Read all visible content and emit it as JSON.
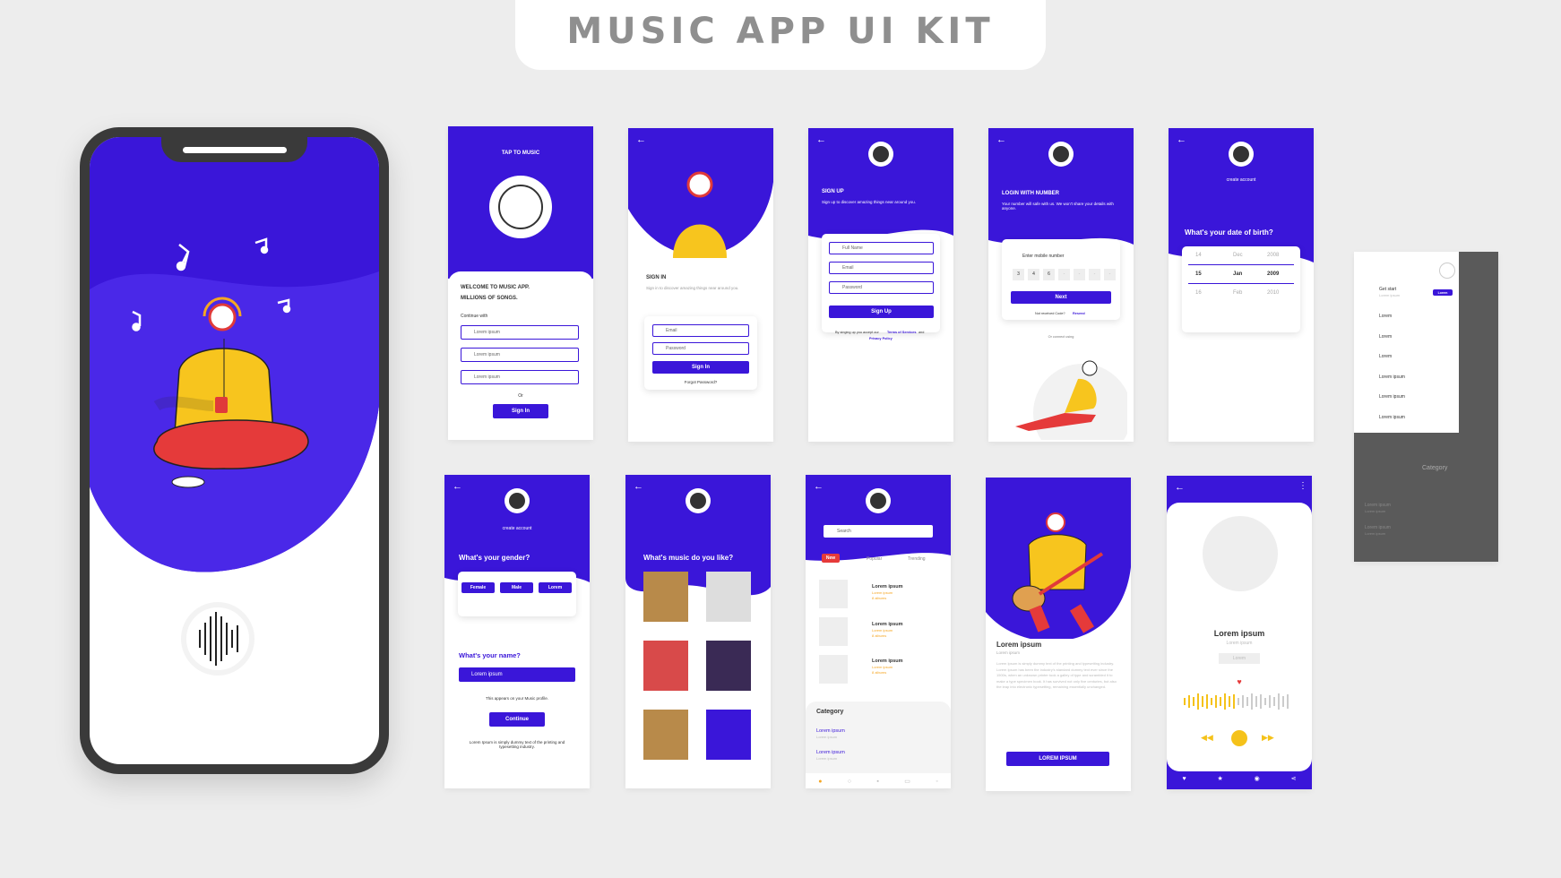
{
  "header": {
    "title": "MUSIC APP UI KIT"
  },
  "colors": {
    "primary": "#3a16d9",
    "accent": "#f5c21a",
    "red": "#e63a3a",
    "bg": "#ededed"
  },
  "tap_screen": {
    "title": "TAP TO MUSIC",
    "welcome": "WELCOME TO MUSIC APP.",
    "millions": "MILLIONS OF SONGS.",
    "continue_with": "Continue with",
    "options": [
      "Lorem ipsum",
      "Lorem ipsum",
      "Lorem ipsum"
    ],
    "or": "Or",
    "signin": "Sign In"
  },
  "signin_screen": {
    "title": "SIGN IN",
    "subtitle": "Sign in to discover amazing things near around you.",
    "email": "Email",
    "password": "Password",
    "button": "Sign In",
    "forgot": "Forgot Password?"
  },
  "signup_screen": {
    "title": "SIGN UP",
    "subtitle": "Sign up to discover amazing things near around you.",
    "fullname": "Full Name",
    "email": "Email",
    "password": "Password",
    "button": "Sign Up",
    "terms_pre": "By singing up you accept our",
    "terms": "Terms of Services",
    "and": "and",
    "privacy": "Privacy Policy"
  },
  "number_screen": {
    "title": "LOGIN WITH NUMBER",
    "subtitle": "Your number will safe with us. We won't share your details with anyone.",
    "placeholder": "Enter mobile number",
    "digits": [
      "3",
      "4",
      "6",
      "-",
      "-",
      "-",
      "-"
    ],
    "button": "Next",
    "not_received": "Not received Code?",
    "resend": "Resend",
    "or_connect": "Or connect using"
  },
  "dob_screen": {
    "title": "create account",
    "question": "What's your date of birth?",
    "rows": [
      {
        "day": "14",
        "month": "Dec",
        "year": "2008"
      },
      {
        "day": "15",
        "month": "Jan",
        "year": "2009"
      },
      {
        "day": "16",
        "month": "Feb",
        "year": "2010"
      }
    ]
  },
  "menu_screen": {
    "get_start": "Get start",
    "sub": "Lorem ipsum",
    "badge": "Lorem",
    "items": [
      "Lorem",
      "Lorem",
      "Lorem",
      "Lorem ipsum",
      "Lorem ipsum",
      "Lorem ipsum"
    ],
    "bg_section": "Category",
    "bg_rows": [
      "Lorem ipsum",
      "Lorem ipsum"
    ],
    "bg_sub": "Lorem ipsum"
  },
  "gender_screen": {
    "title": "create account",
    "question": "What's your gender?",
    "options": [
      "Female",
      "Male",
      "Lorem"
    ],
    "name_q": "What's your name?",
    "name_value": "Lorem ipsum",
    "note": "This appears on your Music profile.",
    "button": "Continue",
    "footer": "Lorem Ipsum is simply dummy text of the printing and typesetting industry."
  },
  "music_like_screen": {
    "question": "What's music do you like?"
  },
  "home_screen": {
    "search": "Search",
    "tabs": [
      "New",
      "Popular",
      "Trending"
    ],
    "tracks": [
      {
        "title": "Lorem ipsum",
        "sub": "Lorem ipsum",
        "albums": "8 albums"
      },
      {
        "title": "Lorem ipsum",
        "sub": "Lorem ipsum",
        "albums": "8 albums"
      },
      {
        "title": "Lorem ipsum",
        "sub": "Lorem ipsum",
        "albums": "8 albums"
      }
    ],
    "category": "Category",
    "cats": [
      "Lorem ipsum",
      "Lorem ipsum"
    ],
    "cat_sub": "Lorem ipsum"
  },
  "artist_screen": {
    "name": "Lorem ipsum",
    "sub": "Lorem ipsum",
    "body": "Lorem Ipsum is simply dummy text of the printing and typesetting industry. Lorem Ipsum has been the industry's standard dummy text ever since the 1500s, when an unknown printer took a galley of type and scrambled it to make a type specimen book. It has survived not only five centuries, but also the leap into electronic typesetting, remaining essentially unchanged.",
    "button": "LOREM IPSUM"
  },
  "player_screen": {
    "name": "Lorem ipsum",
    "sub": "Lorem ipsum",
    "tag": "Lorem"
  }
}
